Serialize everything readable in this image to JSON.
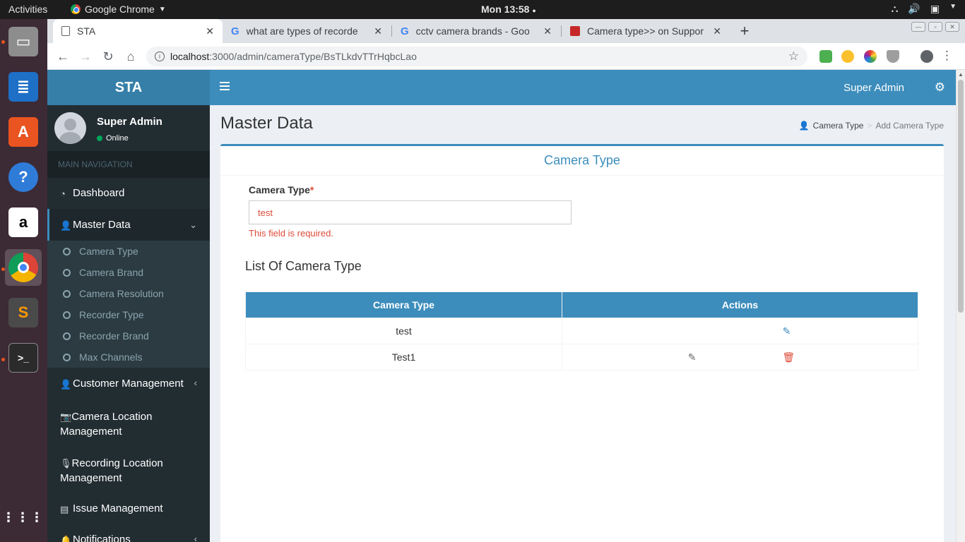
{
  "os": {
    "activities": "Activities",
    "app_name": "Google Chrome",
    "clock": "Mon 13:58"
  },
  "browser": {
    "tabs": [
      {
        "title": "STA"
      },
      {
        "title": "what are types of recorde"
      },
      {
        "title": "cctv camera brands - Goo"
      },
      {
        "title": "Camera type>> on Suppor"
      }
    ],
    "url_host": "localhost",
    "url_path": ":3000/admin/cameraType/BsTLkdvTTrHqbcLao"
  },
  "app": {
    "logo": "STA",
    "user": {
      "name": "Super Admin",
      "status": "Online"
    },
    "nav_header": "MAIN NAVIGATION",
    "nav": {
      "dashboard": "Dashboard",
      "master_data": "Master Data",
      "customer": "Customer Management",
      "camera_location": "Camera Location Management",
      "recording_location": "Recording Location Management",
      "issue": "Issue Management",
      "notifications": "Notifications"
    },
    "submenu": [
      "Camera Type",
      "Camera Brand",
      "Camera Resolution",
      "Recorder Type",
      "Recorder Brand",
      "Max Channels"
    ],
    "header_user": "Super Admin"
  },
  "content": {
    "page_title": "Master Data",
    "breadcrumb": {
      "item1": "Camera Type",
      "item2": "Add Camera Type"
    },
    "box_title": "Camera Type",
    "form": {
      "label": "Camera Type",
      "required_mark": "*",
      "value": "test",
      "error": "This field is required."
    },
    "list_title": "List Of Camera Type",
    "table": {
      "headers": [
        "Camera Type",
        "Actions"
      ],
      "rows": [
        {
          "camera_type": "test"
        },
        {
          "camera_type": "Test1"
        }
      ]
    }
  }
}
